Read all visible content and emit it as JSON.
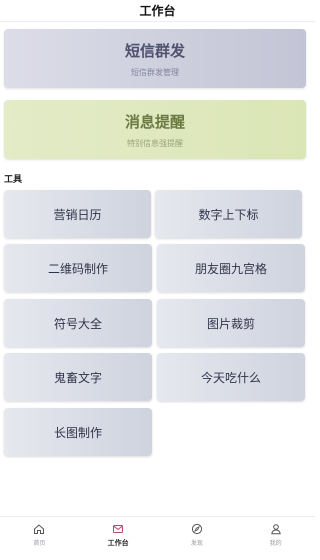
{
  "header": {
    "title": "工作台"
  },
  "banners": [
    {
      "title": "短信群发",
      "subtitle": "短信群发管理"
    },
    {
      "title": "消息提醒",
      "subtitle": "特别信息强提醒"
    }
  ],
  "tools_section": {
    "title": "工具",
    "items": [
      {
        "label": "营销日历"
      },
      {
        "label": "数字上下标"
      },
      {
        "label": "二维码制作"
      },
      {
        "label": "朋友圈九宫格"
      },
      {
        "label": "符号大全"
      },
      {
        "label": "图片裁剪"
      },
      {
        "label": "鬼畜文字"
      },
      {
        "label": "今天吃什么"
      },
      {
        "label": "长图制作"
      }
    ]
  },
  "tabbar": {
    "active": "工作台",
    "items": [
      {
        "label": "首页",
        "icon": "home-icon"
      },
      {
        "label": "工作台",
        "icon": "mail-icon"
      },
      {
        "label": "发现",
        "icon": "compass-icon"
      },
      {
        "label": "我的",
        "icon": "user-icon"
      }
    ]
  },
  "colors": {
    "sms_banner": "#c8c9d9",
    "reminder_banner": "#dfe8bf",
    "tool_card": "#dcdfe7",
    "active_tab": "#222222",
    "inactive_tab": "#9a9aa6"
  }
}
